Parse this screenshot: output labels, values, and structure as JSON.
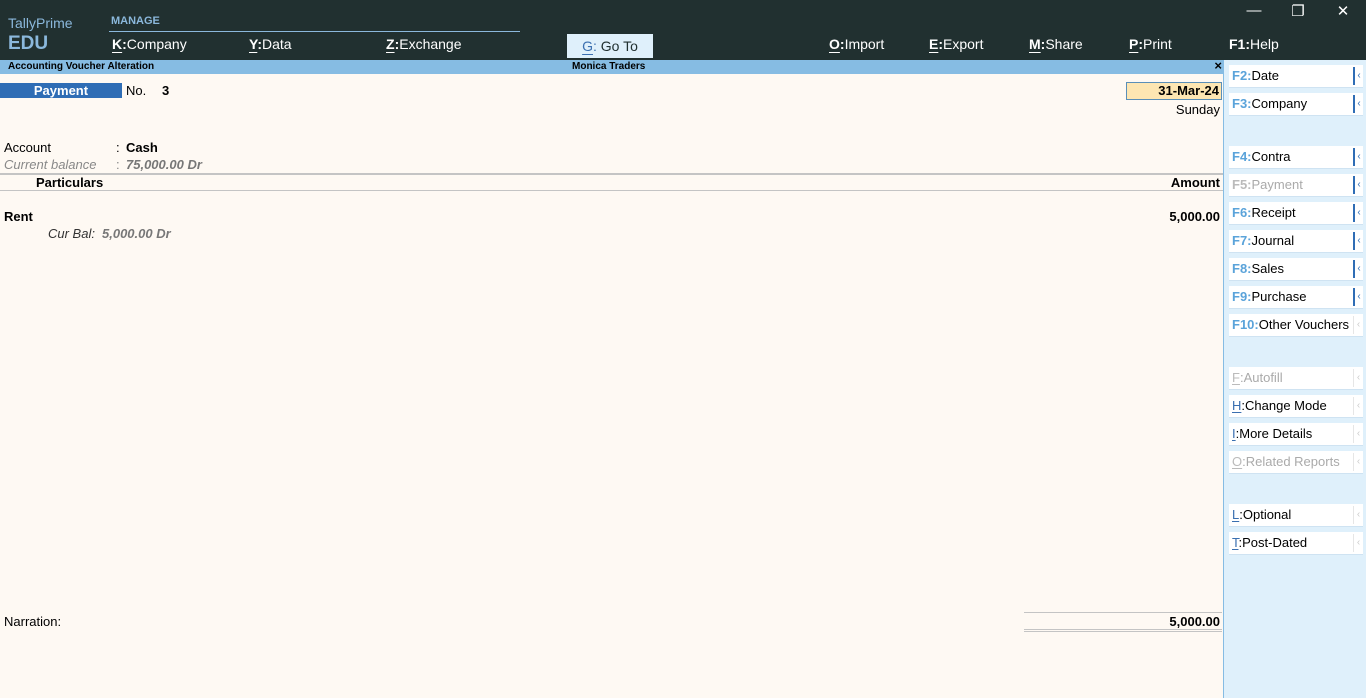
{
  "app": {
    "brand_line1": "TallyPrime",
    "brand_line2": "EDU",
    "section_label": "MANAGE"
  },
  "top_menu": [
    {
      "key": "K",
      "label": "Company"
    },
    {
      "key": "Y",
      "label": "Data"
    },
    {
      "key": "Z",
      "label": "Exchange"
    },
    {
      "key": "G",
      "label": "Go To"
    },
    {
      "key": "O",
      "label": "Import"
    },
    {
      "key": "E",
      "label": "Export"
    },
    {
      "key": "M",
      "label": "Share"
    },
    {
      "key": "P",
      "label": "Print"
    },
    {
      "key": "F1",
      "label": "Help"
    }
  ],
  "window_controls": {
    "minimize": "—",
    "restore": "❐",
    "close": "✕"
  },
  "titlebar": {
    "screen": "Accounting Voucher Alteration",
    "company": "Monica Traders",
    "close": "×"
  },
  "voucher": {
    "type": "Payment",
    "no_label": "No.",
    "number": "3",
    "date": "31-Mar-24",
    "day": "Sunday",
    "account_label": "Account",
    "account_value": "Cash",
    "balance_label": "Current balance",
    "balance_value": "75,000.00 Dr",
    "colon": ":",
    "columns": {
      "particulars": "Particulars",
      "amount": "Amount"
    },
    "entries": [
      {
        "ledger": "Rent",
        "amount": "5,000.00",
        "cur_bal_label": "Cur Bal:",
        "cur_bal_value": "5,000.00 Dr"
      }
    ],
    "narration_label": "Narration:",
    "total": "5,000.00"
  },
  "sidebar": {
    "arrow": "‹",
    "buttons": [
      {
        "key": "F2:",
        "label": "Date",
        "disabled": false
      },
      {
        "key": "F3:",
        "label": "Company",
        "disabled": false
      },
      {
        "key": "F4:",
        "label": "Contra",
        "disabled": false
      },
      {
        "key": "F5:",
        "label": "Payment",
        "disabled": true
      },
      {
        "key": "F6:",
        "label": "Receipt",
        "disabled": false
      },
      {
        "key": "F7:",
        "label": "Journal",
        "disabled": false
      },
      {
        "key": "F8:",
        "label": "Sales",
        "disabled": false
      },
      {
        "key": "F9:",
        "label": "Purchase",
        "disabled": false
      },
      {
        "key": "F10:",
        "label": "Other Vouchers",
        "disabled": false
      },
      {
        "key": "F",
        "label": "Autofill",
        "disabled": true
      },
      {
        "key": "H",
        "label": "Change Mode",
        "disabled": false
      },
      {
        "key": "I",
        "label": "More Details",
        "disabled": false
      },
      {
        "key": "O",
        "label": "Related Reports",
        "disabled": true
      },
      {
        "key": "L",
        "label": "Optional",
        "disabled": false
      },
      {
        "key": "T",
        "label": "Post-Dated",
        "disabled": false
      }
    ]
  }
}
